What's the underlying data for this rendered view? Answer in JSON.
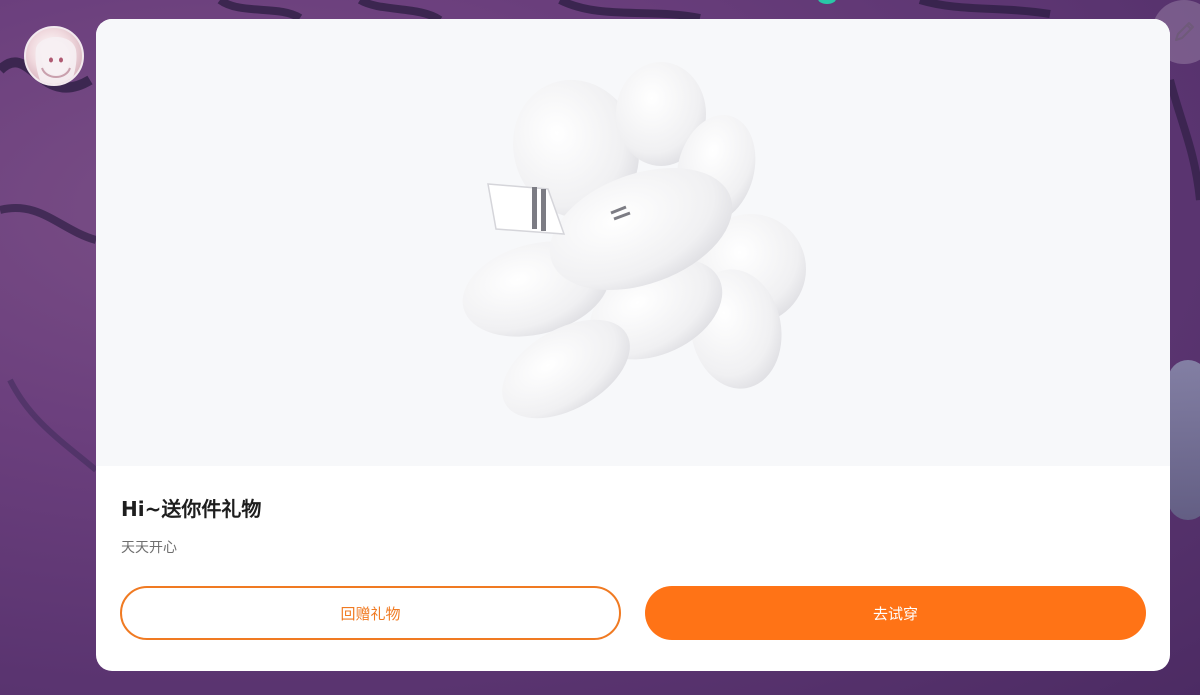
{
  "card": {
    "title": "Hi~送你件礼物",
    "subtitle": "天天开心"
  },
  "buttons": {
    "gift_label": "回赠礼物",
    "try_on_label": "去试穿"
  },
  "icons": {
    "avatar": "user-avatar",
    "edit": "pencil-icon",
    "gift_item": "nine-tailed-fox-tail-icon"
  },
  "colors": {
    "accent": "#ff7316",
    "outline": "#f07a22",
    "card_bg": "#ffffff",
    "preview_bg": "#f7f8fa",
    "background": "#6b3f7d"
  }
}
